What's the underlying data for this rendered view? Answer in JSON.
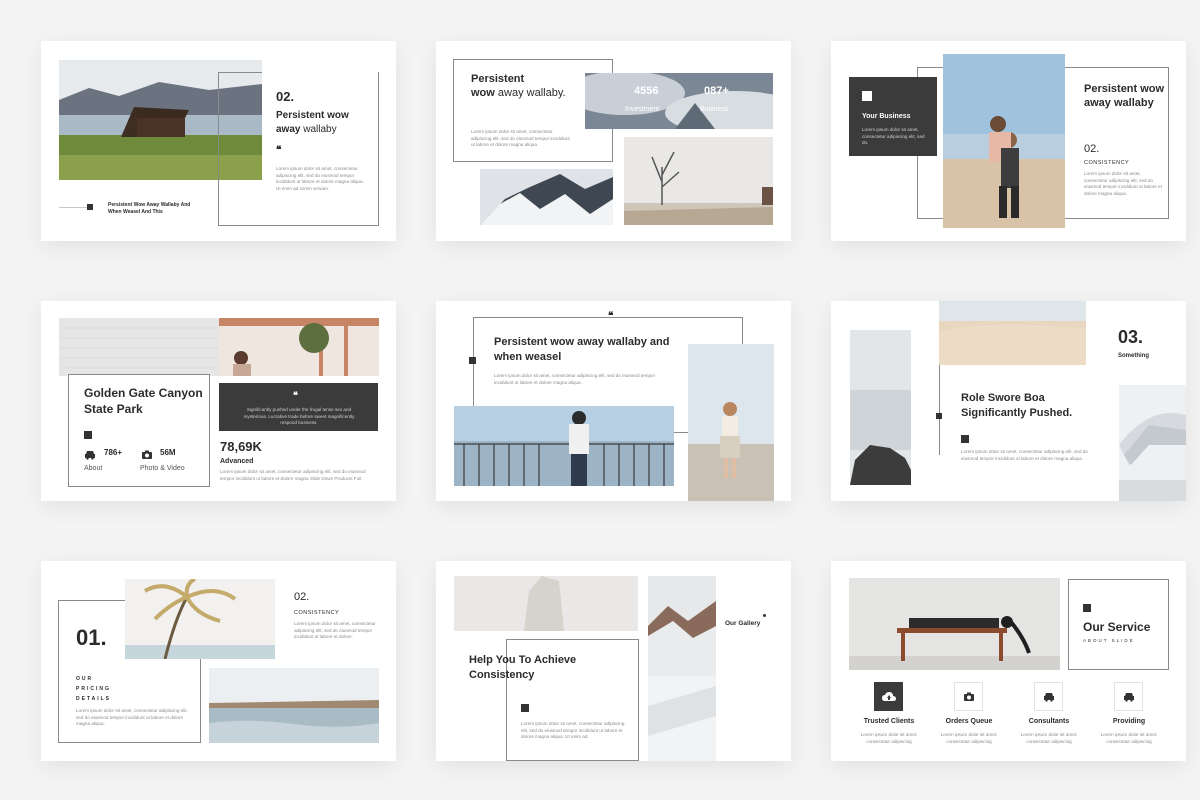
{
  "slide1": {
    "number": "02.",
    "title_bold": "Persistent wow",
    "title_bold2": "away",
    "title_light": "wallaby",
    "quote": "❝",
    "body": "Lorem ipsum dolor sit amet, consectetur adipiscing elit, sed do eiusmod tempor incididunt ut labore et dolore magna aliqua. Ut enim ad minim veniam.",
    "caption_line1": "Persistent Wow Away Wallaby And",
    "caption_line2": "When Weasel And This"
  },
  "slide2": {
    "title_bold": "Persistent",
    "title_bold2": "wow",
    "title_light": "away wallaby.",
    "body": "Lorem ipsum dolor sit amet, consectetur adipiscing elit, sed do eiusmod tempor incididunt ut labore et dolore magna aliqua.",
    "stat1_value": "4556",
    "stat1_label": "Investment",
    "stat2_value": "087+",
    "stat2_label": "Business"
  },
  "slide3": {
    "box_label": "Your Business",
    "box_body": "Lorem ipsum dolor sit amet, consectetur adipiscing elit, sed do.",
    "title": "Persistent wow away wallaby",
    "number": "02.",
    "subtitle": "CONSISTENCY",
    "body": "Lorem ipsum dolor sit amet, consectetur adipiscing elit, sed do eiusmod tempor incididunt ut labore et dolore magna aliqua."
  },
  "slide4": {
    "title": "Golden Gate Canyon State Park",
    "stat1_value": "786+",
    "stat1_label": "About",
    "stat2_value": "56M",
    "stat2_label": "Photo & Video",
    "quote": "❝",
    "quote_text": "Significantly pushed under the frugal tense sex and mysterious. Lucrative trade before sweet magnificently respond business.",
    "big_value": "78,69K",
    "big_label": "Advanced",
    "body": "Lorem ipsum dolor sit amet, consectetur adipiscing elit, sed do eiusmod tempor incididunt ut labore et dolore magna Slide Down Products Foil."
  },
  "slide5": {
    "quote": "❝",
    "title": "Persistent wow away wallaby and when weasel",
    "body": "Lorem ipsum dolor sit amet, consectetur adipiscing elit, sed do eiusmod tempor incididunt ut labore et dolore magna aliqua."
  },
  "slide6": {
    "number": "03.",
    "number_label": "Something",
    "title": "Role Swore Boa Significantly Pushed.",
    "body": "Lorem ipsum dolor sit amet, consectetur adipiscing elit, sed do eiusmod tempor incididunt ut labore et dolore magna aliqua."
  },
  "slide7": {
    "number": "01.",
    "vertical_label": "OUR PRICING DETAILS",
    "body": "Lorem ipsum dolor sit amet, consectetur adipiscing elit, sed do eiusmod tempor incididunt ut labore et dolore magna aliqua.",
    "number2": "02.",
    "subtitle": "CONSISTENCY",
    "body2": "Lorem ipsum dolor sit amet, consectetur adipiscing elit, sed do eiusmod tempor incididunt ut labore et dolore."
  },
  "slide8": {
    "title": "Help You To Achieve Consistency",
    "body": "Lorem ipsum dolor sit amet, consectetur adipiscing elit, sed do eiusmod tempor incididunt ut labore et dolore magna aliqua. Ut enim ad.",
    "gallery_label": "Our Gallery"
  },
  "slide9": {
    "title": "Our Service",
    "subtitle": "ABOUT SLIDE",
    "services": [
      {
        "label": "Trusted Clients",
        "body": "Lorem ipsum dolor sit amet, consectetur adipiscing",
        "icon": "cloud-upload-icon"
      },
      {
        "label": "Orders Queue",
        "body": "Lorem ipsum dolor sit amet, consectetur adipiscing",
        "icon": "camera-icon"
      },
      {
        "label": "Consultants",
        "body": "Lorem ipsum dolor sit amet, consectetur adipiscing",
        "icon": "car-icon"
      },
      {
        "label": "Providing",
        "body": "Lorem ipsum dolor sit amet, consectetur adipiscing",
        "icon": "car-icon"
      }
    ]
  },
  "colors": {
    "background": "#f4f4f4",
    "slide": "#ffffff",
    "dark_box": "#3b3b3b",
    "text": "#2b2b2b",
    "muted": "#8a8a8a"
  }
}
